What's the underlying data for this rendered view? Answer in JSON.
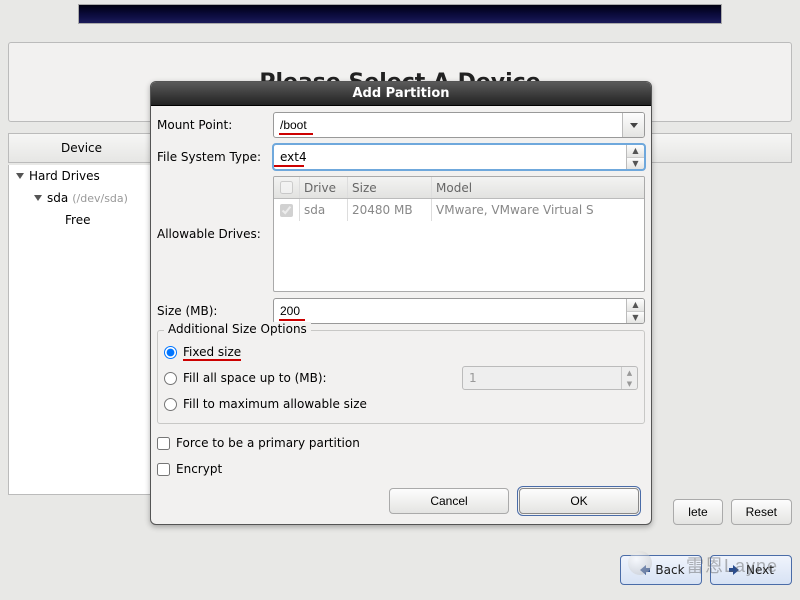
{
  "page": {
    "title": "Please Select A Device",
    "table_header_device": "Device"
  },
  "tree": {
    "root": "Hard Drives",
    "disk_name": "sda",
    "disk_path": "(/dev/sda)",
    "free": "Free"
  },
  "footer": {
    "delete": "lete",
    "reset": "Reset"
  },
  "nav": {
    "back": "Back",
    "next": "Next"
  },
  "dialog": {
    "title": "Add Partition",
    "mount_point_label": "Mount Point:",
    "mount_point_value": "/boot",
    "fs_type_label": "File System Type:",
    "fs_type_value": "ext4",
    "allowable_label": "Allowable Drives:",
    "drive_headers": {
      "drive": "Drive",
      "size": "Size",
      "model": "Model"
    },
    "drives": [
      {
        "checked": true,
        "name": "sda",
        "size": "20480 MB",
        "model": "VMware, VMware Virtual S"
      }
    ],
    "size_label": "Size (MB):",
    "size_value": "200",
    "size_options_legend": "Additional Size Options",
    "opt_fixed": "Fixed size",
    "opt_fill_up": "Fill all space up to (MB):",
    "opt_fill_up_value": "1",
    "opt_fill_max": "Fill to maximum allowable size",
    "chk_primary": "Force to be a primary partition",
    "chk_encrypt": "Encrypt",
    "btn_cancel": "Cancel",
    "btn_ok": "OK"
  },
  "watermark": "雷恩Layne"
}
